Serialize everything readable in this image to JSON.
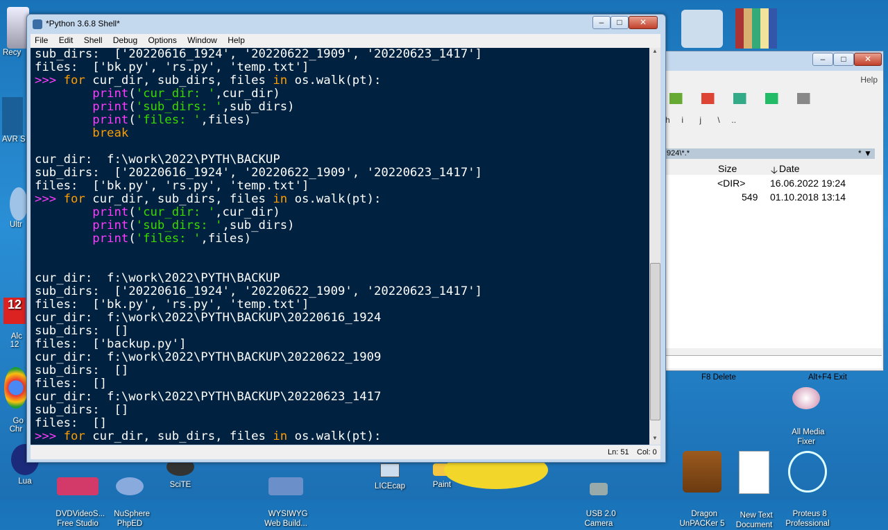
{
  "idle": {
    "title": "*Python 3.6.8 Shell*",
    "menu": [
      "File",
      "Edit",
      "Shell",
      "Debug",
      "Options",
      "Window",
      "Help"
    ],
    "status_line": "Ln: 51",
    "status_col": "Col: 0",
    "lines": [
      [
        [
          "o",
          "sub_dirs:  ['20220616_1924', '20220622_1909', '20220623_1417']"
        ]
      ],
      [
        [
          "o",
          "files:  ['bk.py', 'rs.py', 'temp.txt']"
        ]
      ],
      [
        [
          "p",
          ">>> "
        ],
        [
          "k",
          "for"
        ],
        [
          "o",
          " cur_dir, sub_dirs, files "
        ],
        [
          "k",
          "in"
        ],
        [
          "o",
          " os.walk(pt):"
        ]
      ],
      [
        [
          "o",
          "        "
        ],
        [
          "b",
          "print"
        ],
        [
          "o",
          "("
        ],
        [
          "s",
          "'cur_dir: '"
        ],
        [
          "o",
          ",cur_dir)"
        ]
      ],
      [
        [
          "o",
          "        "
        ],
        [
          "b",
          "print"
        ],
        [
          "o",
          "("
        ],
        [
          "s",
          "'sub_dirs: '"
        ],
        [
          "o",
          ",sub_dirs)"
        ]
      ],
      [
        [
          "o",
          "        "
        ],
        [
          "b",
          "print"
        ],
        [
          "o",
          "("
        ],
        [
          "s",
          "'files: '"
        ],
        [
          "o",
          ",files)"
        ]
      ],
      [
        [
          "o",
          "        "
        ],
        [
          "k",
          "break"
        ]
      ],
      [
        [
          "o",
          ""
        ]
      ],
      [
        [
          "o",
          "cur_dir:  f:\\work\\2022\\PYTH\\BACKUP"
        ]
      ],
      [
        [
          "o",
          "sub_dirs:  ['20220616_1924', '20220622_1909', '20220623_1417']"
        ]
      ],
      [
        [
          "o",
          "files:  ['bk.py', 'rs.py', 'temp.txt']"
        ]
      ],
      [
        [
          "p",
          ">>> "
        ],
        [
          "k",
          "for"
        ],
        [
          "o",
          " cur_dir, sub_dirs, files "
        ],
        [
          "k",
          "in"
        ],
        [
          "o",
          " os.walk(pt):"
        ]
      ],
      [
        [
          "o",
          "        "
        ],
        [
          "b",
          "print"
        ],
        [
          "o",
          "("
        ],
        [
          "s",
          "'cur_dir: '"
        ],
        [
          "o",
          ",cur_dir)"
        ]
      ],
      [
        [
          "o",
          "        "
        ],
        [
          "b",
          "print"
        ],
        [
          "o",
          "("
        ],
        [
          "s",
          "'sub_dirs: '"
        ],
        [
          "o",
          ",sub_dirs)"
        ]
      ],
      [
        [
          "o",
          "        "
        ],
        [
          "b",
          "print"
        ],
        [
          "o",
          "("
        ],
        [
          "s",
          "'files: '"
        ],
        [
          "o",
          ",files)"
        ]
      ],
      [
        [
          "o",
          ""
        ]
      ],
      [
        [
          "o",
          ""
        ]
      ],
      [
        [
          "o",
          "cur_dir:  f:\\work\\2022\\PYTH\\BACKUP"
        ]
      ],
      [
        [
          "o",
          "sub_dirs:  ['20220616_1924', '20220622_1909', '20220623_1417']"
        ]
      ],
      [
        [
          "o",
          "files:  ['bk.py', 'rs.py', 'temp.txt']"
        ]
      ],
      [
        [
          "o",
          "cur_dir:  f:\\work\\2022\\PYTH\\BACKUP\\20220616_1924"
        ]
      ],
      [
        [
          "o",
          "sub_dirs:  []"
        ]
      ],
      [
        [
          "o",
          "files:  ['backup.py']"
        ]
      ],
      [
        [
          "o",
          "cur_dir:  f:\\work\\2022\\PYTH\\BACKUP\\20220622_1909"
        ]
      ],
      [
        [
          "o",
          "sub_dirs:  []"
        ]
      ],
      [
        [
          "o",
          "files:  []"
        ]
      ],
      [
        [
          "o",
          "cur_dir:  f:\\work\\2022\\PYTH\\BACKUP\\20220623_1417"
        ]
      ],
      [
        [
          "o",
          "sub_dirs:  []"
        ]
      ],
      [
        [
          "o",
          "files:  []"
        ]
      ],
      [
        [
          "p",
          ">>> "
        ],
        [
          "k",
          "for"
        ],
        [
          "o",
          " cur_dir, sub_dirs, files "
        ],
        [
          "k",
          "in"
        ],
        [
          "o",
          " os.walk(pt):"
        ]
      ]
    ]
  },
  "filemanager": {
    "help": "Help",
    "path": "924\\*.*",
    "col_size": "Size",
    "col_date": "Date",
    "rows": [
      {
        "size": "<DIR>",
        "date": "16.06.2022 19:24"
      },
      {
        "size": "549",
        "date": "01.10.2018 13:14"
      }
    ],
    "f8": "F8 Delete",
    "altf4": "Alt+F4 Exit"
  },
  "desktop_icons": [
    {
      "label": "Recy"
    },
    {
      "label": "AVR S"
    },
    {
      "label": "Ultr"
    },
    {
      "label": "Alc\n12"
    },
    {
      "label": "Go\nChr"
    },
    {
      "label": "Lua"
    },
    {
      "label": "DVDVideoS...\nFree Studio"
    },
    {
      "label": "NuSphere\nPhpED"
    },
    {
      "label": "SciTE"
    },
    {
      "label": "WYSIWYG\nWeb Build..."
    },
    {
      "label": "LICEcap"
    },
    {
      "label": "Paint"
    },
    {
      "label": "USB 2.0\nCamera"
    },
    {
      "label": "Dragon\nUnPACKer 5"
    },
    {
      "label": "New Text\nDocument"
    },
    {
      "label": "Proteus 8\nProfessional"
    },
    {
      "label": "All Media\nFixer"
    }
  ],
  "colors": {
    "console_bg": "#002240",
    "keyword": "#ff9d00",
    "builtin": "#ff3bff",
    "string": "#3ad900"
  }
}
